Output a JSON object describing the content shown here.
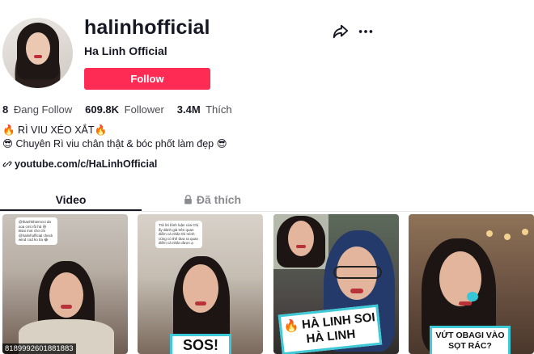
{
  "profile": {
    "username": "halinhofficial",
    "nickname": "Ha Linh Official",
    "follow_label": "Follow"
  },
  "stats": {
    "following_count": "8",
    "following_label": "Đang Follow",
    "followers_count": "609.8K",
    "followers_label": "Follower",
    "likes_count": "3.4M",
    "likes_label": "Thích"
  },
  "bio": {
    "line1": "🔥 RÌ VIU XÉO XẮT🔥",
    "line2": "😎 Chuyên Rì viu chân thật & bóc phốt làm đẹp 😎"
  },
  "link": {
    "icon": "link-icon",
    "text": "youtube.com/c/HaLinhOfficial"
  },
  "tabs": [
    {
      "label": "Video",
      "active": true
    },
    {
      "label": "Đã thích",
      "icon": "lock-icon",
      "active": false
    }
  ],
  "videos": [
    {
      "comment": "@thanhkhiemcni da xoa cmt rồi hả 😆 Bsai mot cho chi @halinhofficial check wind cod ko tía 😂",
      "id_text": "8189992601881883"
    },
    {
      "comment": "Trả lời bình luận của Chị ấy đánh giá trên quan điểm cá nhân thì mình cũng có thể đưa ra quan điểm cá nhân được ạ",
      "overlay": "SOS!"
    },
    {
      "overlay": "🔥 HÀ LINH SOI HÀ LINH"
    },
    {
      "overlay": "VỨT OBAGI VÀO SỌT RÁC?"
    }
  ],
  "colors": {
    "follow_button": "#fe2c55",
    "overlay_border": "#3ec9d6"
  }
}
